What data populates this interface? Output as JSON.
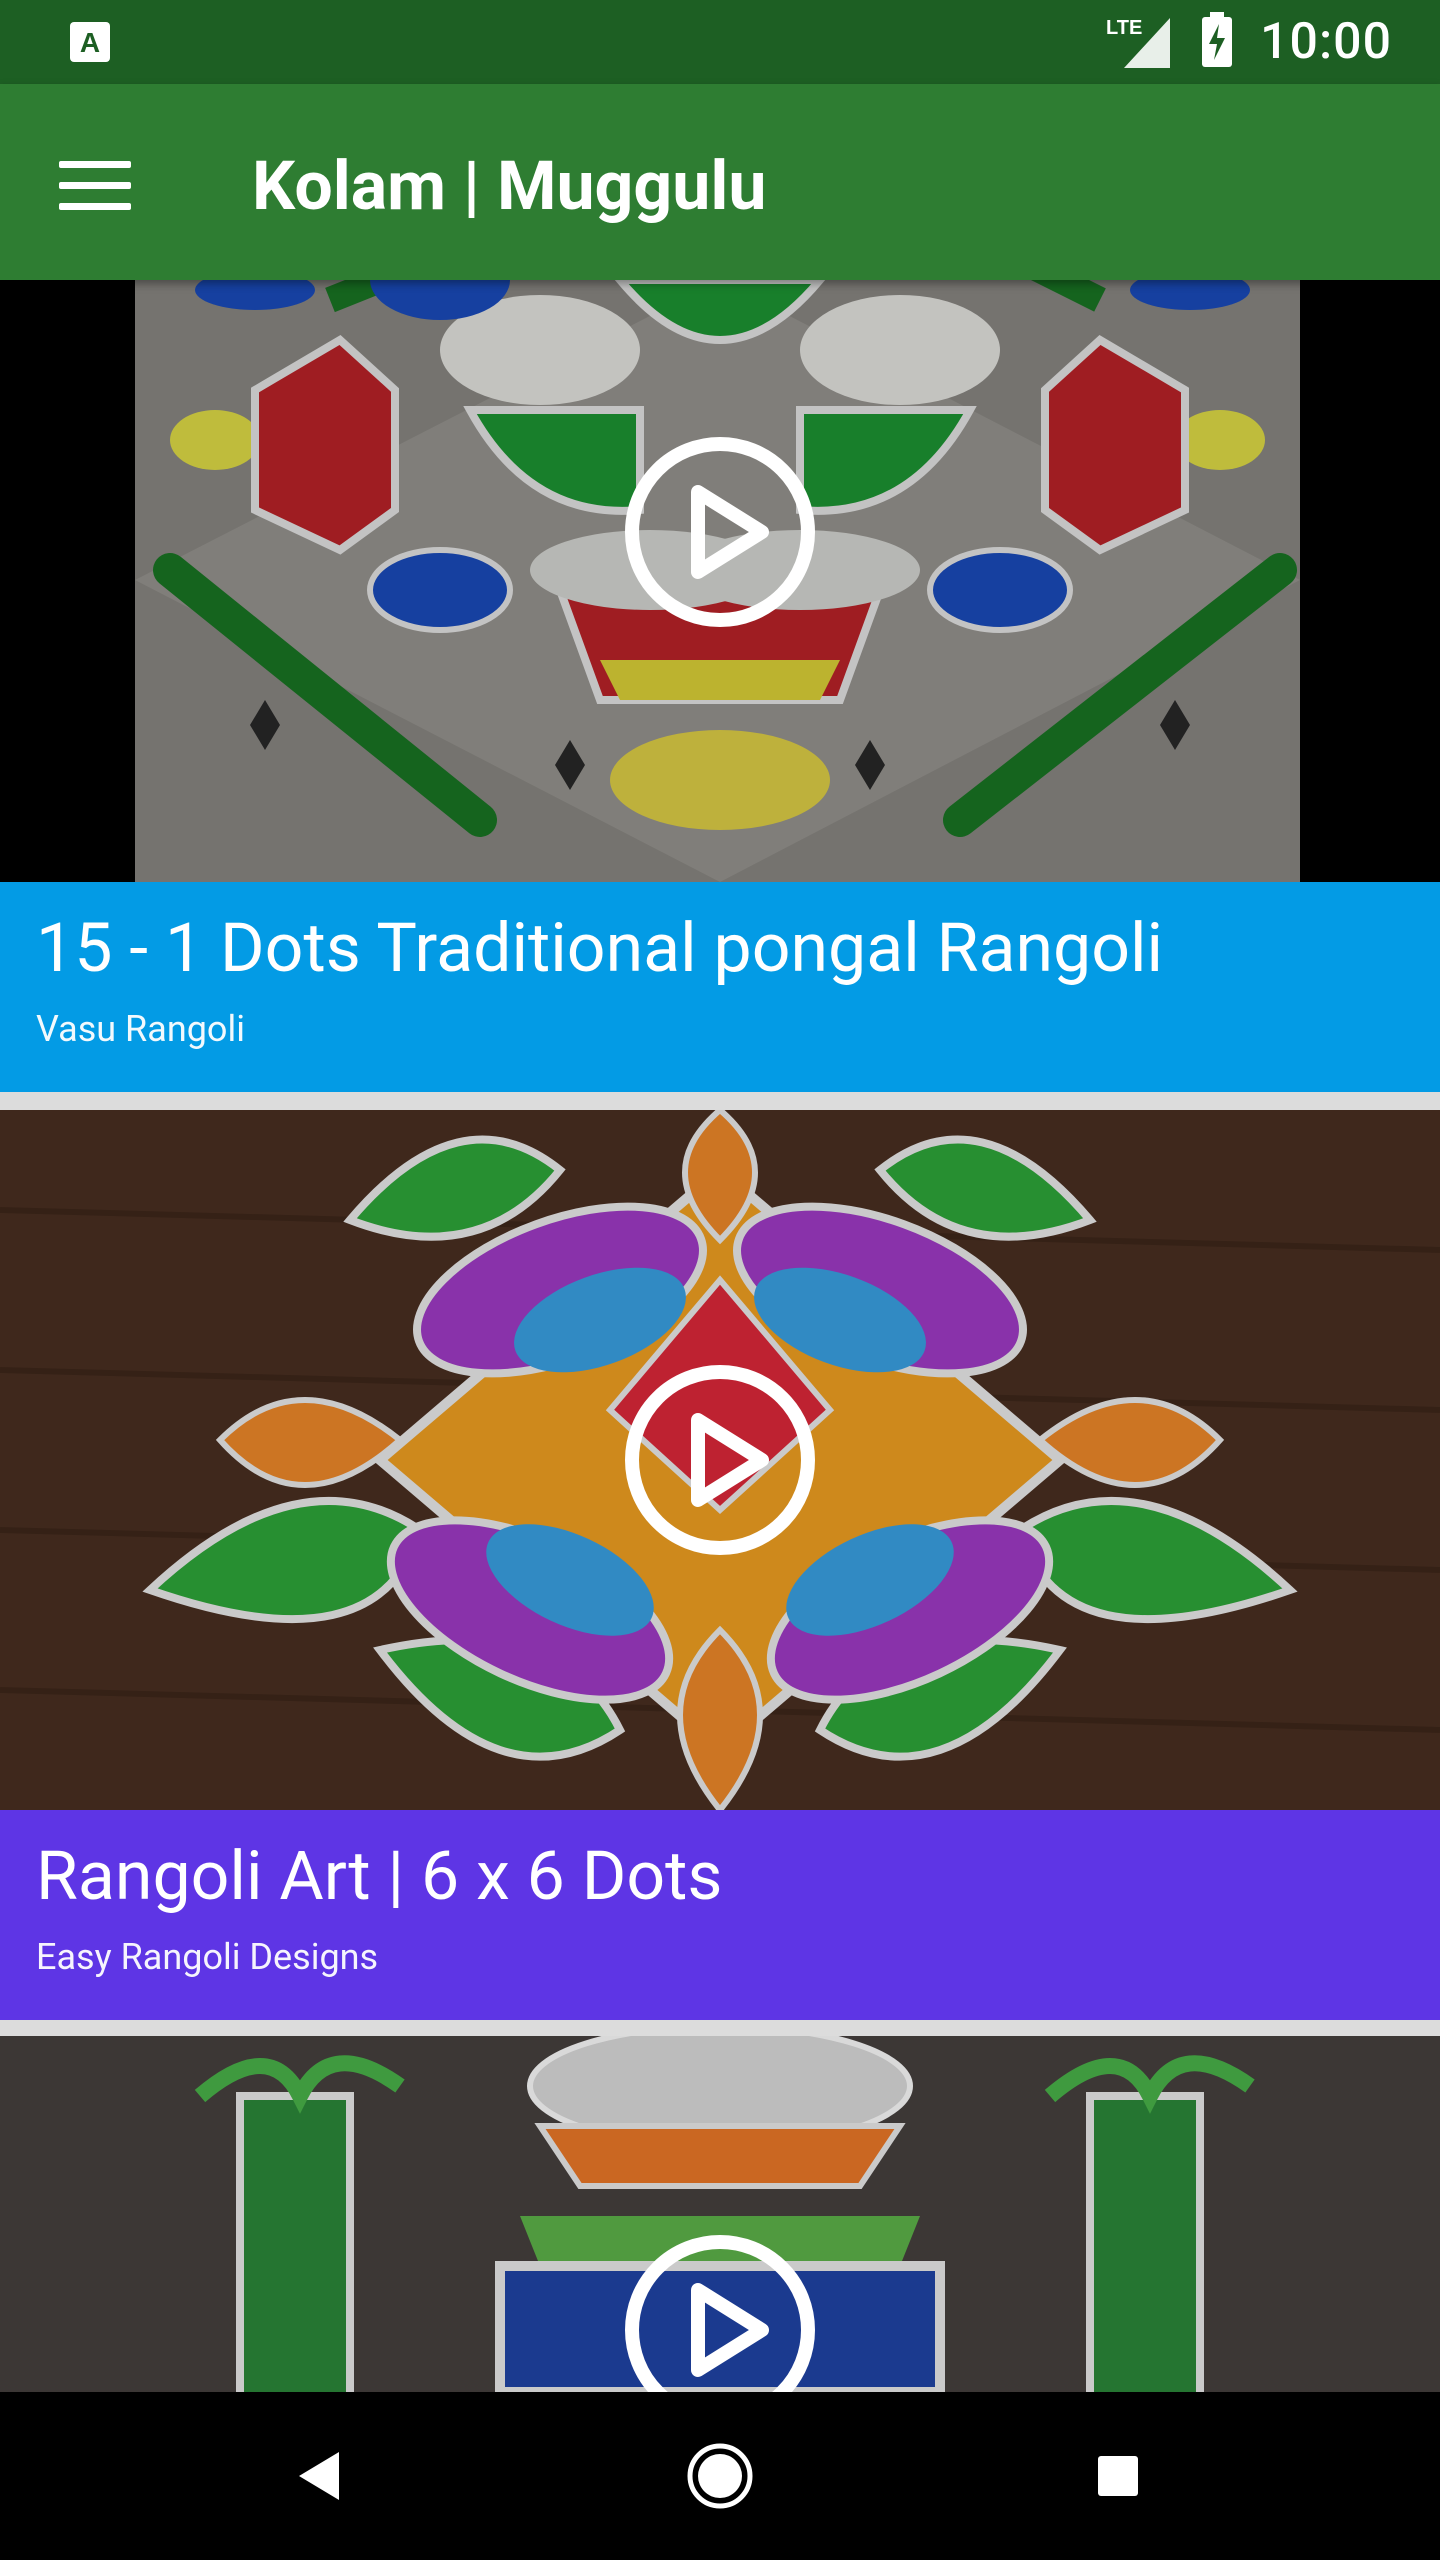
{
  "status_bar": {
    "time": "10:00",
    "network": "LTE",
    "icons": [
      "app-notification-icon",
      "lte-signal-icon",
      "battery-charging-icon"
    ]
  },
  "toolbar": {
    "title": "Kolam | Muggulu",
    "menu_icon": "hamburger-menu-icon"
  },
  "videos": [
    {
      "title": "15 - 1 Dots Traditional pongal Rangoli",
      "channel": "Vasu Rangoli",
      "bar_color": "#039be5"
    },
    {
      "title": "Rangoli Art | 6 x 6 Dots",
      "channel": "Easy Rangoli Designs",
      "bar_color": "#5e35e5"
    },
    {
      "title": "",
      "channel": "",
      "bar_color": ""
    }
  ],
  "nav_bar": {
    "buttons": [
      "back-icon",
      "home-icon",
      "recents-icon"
    ]
  }
}
